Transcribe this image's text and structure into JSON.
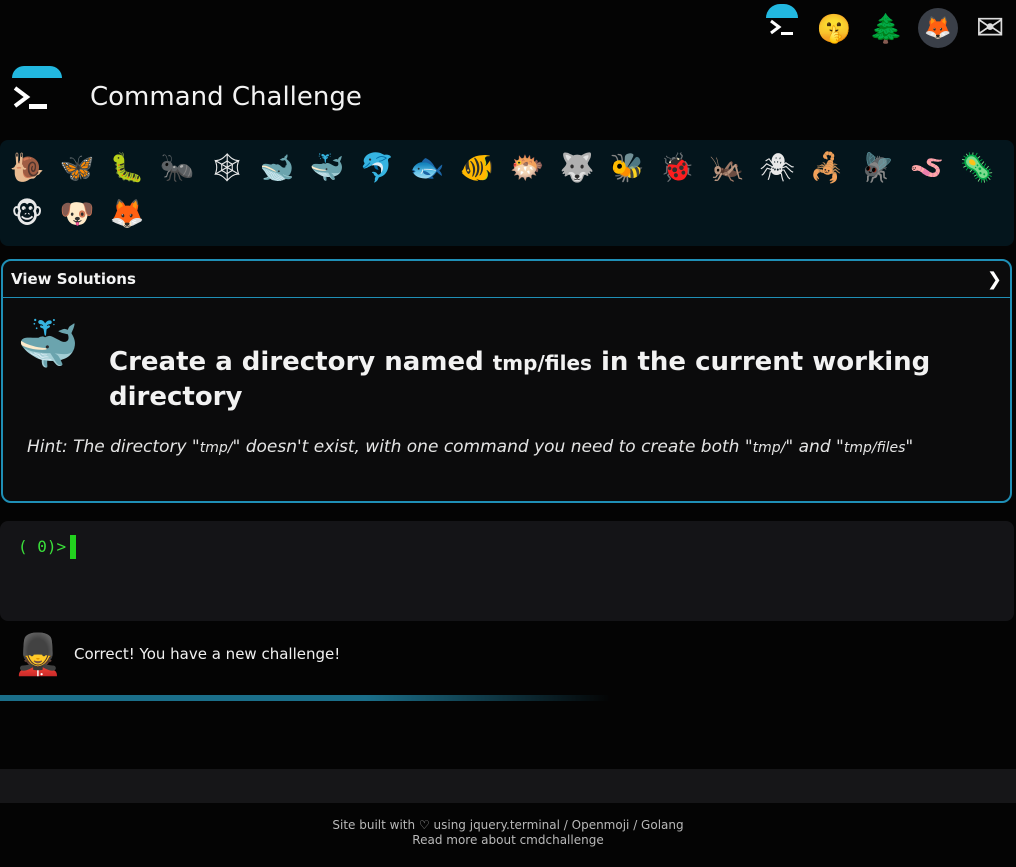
{
  "header": {
    "title": "Command Challenge",
    "icons": [
      {
        "name": "terminal-icon",
        "glyph": "≻_"
      },
      {
        "name": "shushing-face-icon",
        "glyph": "🤫"
      },
      {
        "name": "tree-icon",
        "glyph": "🌲"
      },
      {
        "name": "gitlab-fox-icon",
        "glyph": "🦊"
      },
      {
        "name": "mail-icon",
        "glyph": "✉"
      }
    ]
  },
  "animals": [
    {
      "name": "snail-icon",
      "glyph": "🐌"
    },
    {
      "name": "butterfly-icon",
      "glyph": "🦋"
    },
    {
      "name": "caterpillar-icon",
      "glyph": "🐛"
    },
    {
      "name": "ant-icon",
      "glyph": "🐜"
    },
    {
      "name": "spider-web-icon",
      "glyph": "🕸"
    },
    {
      "name": "whale-icon",
      "glyph": "🐋"
    },
    {
      "name": "spouting-whale-icon",
      "glyph": "🐳"
    },
    {
      "name": "dolphin-icon",
      "glyph": "🐬"
    },
    {
      "name": "fish-icon",
      "glyph": "🐟"
    },
    {
      "name": "tropical-fish-icon",
      "glyph": "🐠"
    },
    {
      "name": "blowfish-icon",
      "glyph": "🐡"
    },
    {
      "name": "wolf-icon",
      "glyph": "🐺"
    },
    {
      "name": "bee-icon",
      "glyph": "🐝"
    },
    {
      "name": "ladybug-icon",
      "glyph": "🐞"
    },
    {
      "name": "cricket-icon",
      "glyph": "🦗"
    },
    {
      "name": "spider-icon",
      "glyph": "🕷"
    },
    {
      "name": "scorpion-icon",
      "glyph": "🦂"
    },
    {
      "name": "fly-icon",
      "glyph": "🪰"
    },
    {
      "name": "worm-icon",
      "glyph": "🪱"
    },
    {
      "name": "microbe-icon",
      "glyph": "🦠"
    },
    {
      "name": "monkey-icon",
      "glyph": "🐵"
    },
    {
      "name": "dog-icon",
      "glyph": "🐶"
    },
    {
      "name": "fox-icon",
      "glyph": "🦊"
    }
  ],
  "challenge": {
    "solutions_label": "View Solutions",
    "chevron": "❯",
    "icon": "🐳",
    "title_pre": "Create a directory named ",
    "title_code": "tmp/files",
    "title_post": " in the current working directory",
    "hint_1": "Hint: The directory \"",
    "hint_code_1": "tmp/",
    "hint_2": "\" doesn't exist, with one command you need to create both \"",
    "hint_code_2": "tmp/",
    "hint_3": "\" and \"",
    "hint_code_3": "tmp/files",
    "hint_4": "\""
  },
  "terminal": {
    "prompt": "( 0)>"
  },
  "feedback": {
    "icon": "💂",
    "text": "Correct! You have a new challenge!"
  },
  "footer": {
    "built_prefix": "Site built with ♡ using ",
    "jquery": "jquery.terminal",
    "sep1": " / ",
    "openmoji": "Openmoji",
    "sep2": " / ",
    "golang": "Golang",
    "read_more": "Read more about cmdchallenge"
  }
}
